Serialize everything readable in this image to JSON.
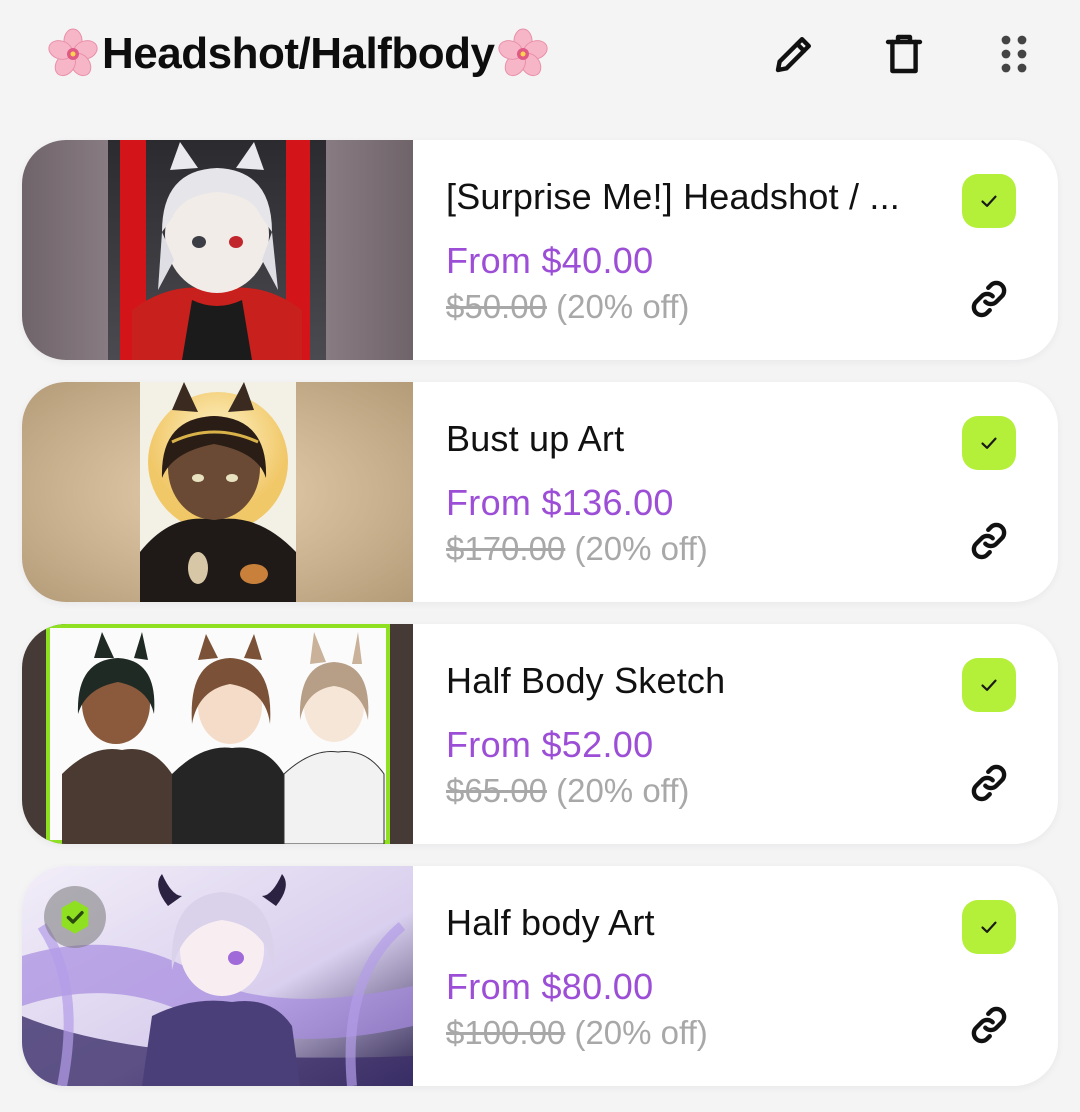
{
  "header": {
    "title": "Headshot/Halfbody",
    "icons": [
      "cherry-blossom-icon",
      "pencil-icon",
      "trash-icon",
      "drag-handle-icon"
    ]
  },
  "items": [
    {
      "name": "[Surprise Me!] Headshot / ...",
      "price": "From $40.00",
      "original_price": "$50.00",
      "discount": "(20% off)",
      "selected": true
    },
    {
      "name": "Bust up Art",
      "price": "From $136.00",
      "original_price": "$170.00",
      "discount": "(20% off)",
      "selected": true
    },
    {
      "name": "Half Body Sketch",
      "price": "From $52.00",
      "original_price": "$65.00",
      "discount": "(20% off)",
      "selected": true
    },
    {
      "name": "Half body Art",
      "price": "From $80.00",
      "original_price": "$100.00",
      "discount": "(20% off)",
      "selected": true
    }
  ],
  "colors": {
    "accent_price": "#9c4fd6",
    "check_bg": "#b4ef3a",
    "muted": "#a8a8a8",
    "background": "#f4f4f5"
  }
}
